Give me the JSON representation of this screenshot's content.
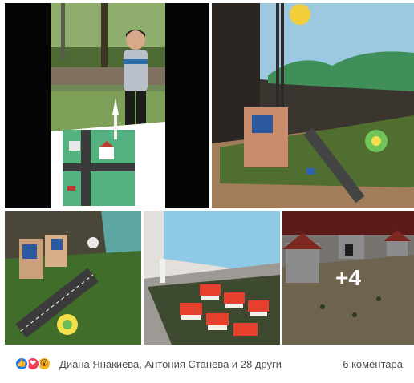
{
  "photos": [
    {
      "id": "photo-1",
      "subject": "boy presenting model"
    },
    {
      "id": "photo-2",
      "subject": "model with painted sun backdrop"
    },
    {
      "id": "photo-3",
      "subject": "model with solar houses and flower fountain"
    },
    {
      "id": "photo-4",
      "subject": "model with red roof houses"
    },
    {
      "id": "photo-5",
      "subject": "model with white houses",
      "more_overlay": "+4"
    }
  ],
  "footer": {
    "reactions": [
      "like-icon",
      "love-icon",
      "wow-icon"
    ],
    "reacted_by": "Диана Янакиева, Антония Станева и 28 други",
    "comments": "6 коментара"
  }
}
